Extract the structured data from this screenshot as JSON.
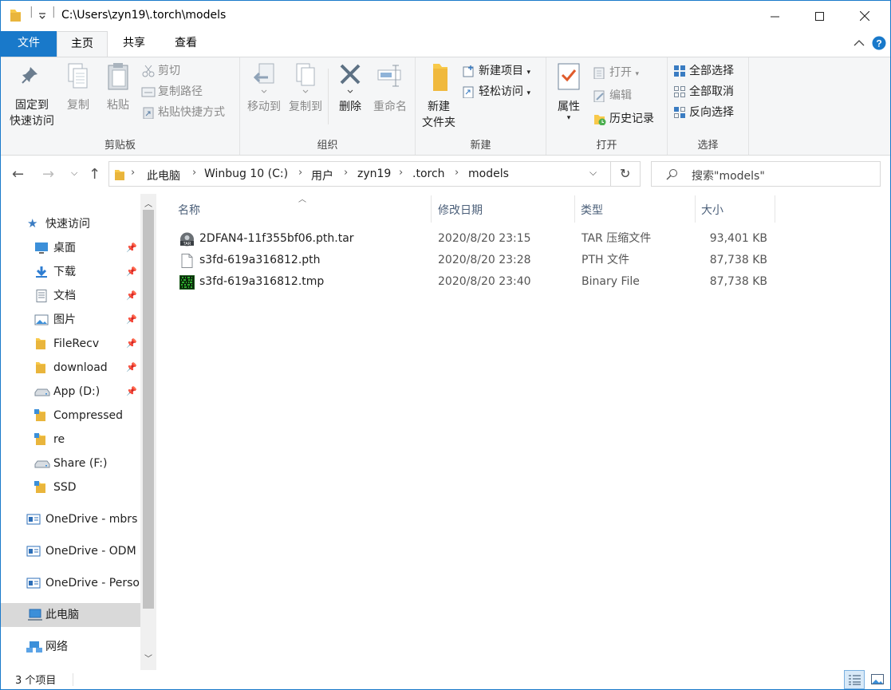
{
  "window": {
    "title": "C:\\Users\\zyn19\\.torch\\models"
  },
  "ribbon_tabs": [
    {
      "label": "文件"
    },
    {
      "label": "主页"
    },
    {
      "label": "共享"
    },
    {
      "label": "查看"
    }
  ],
  "ribbon": {
    "clipboard": {
      "label": "剪贴板",
      "pin": "固定到",
      "pin2": "快速访问",
      "copy": "复制",
      "paste": "粘贴",
      "cut": "剪切",
      "copy_path": "复制路径",
      "paste_shortcut": "粘贴快捷方式"
    },
    "organize": {
      "label": "组织",
      "move_to": "移动到",
      "copy_to": "复制到",
      "delete": "删除",
      "rename": "重命名"
    },
    "new": {
      "label": "新建",
      "new_folder": "新建",
      "new_folder2": "文件夹",
      "new_item": "新建项目",
      "easy_access": "轻松访问"
    },
    "open": {
      "label": "打开",
      "properties": "属性",
      "open": "打开",
      "edit": "编辑",
      "history": "历史记录"
    },
    "select": {
      "label": "选择",
      "select_all": "全部选择",
      "select_none": "全部取消",
      "invert": "反向选择"
    }
  },
  "address": {
    "crumbs": [
      "此电脑",
      "Winbug 10 (C:)",
      "用户",
      "zyn19",
      ".torch",
      "models"
    ],
    "search_placeholder": "搜索\"models\""
  },
  "nav": {
    "quick_access": "快速访问",
    "items": [
      {
        "label": "桌面",
        "icon": "desktop-icon",
        "pinned": true
      },
      {
        "label": "下载",
        "icon": "download-icon",
        "pinned": true
      },
      {
        "label": "文档",
        "icon": "document-icon",
        "pinned": true
      },
      {
        "label": "图片",
        "icon": "picture-icon",
        "pinned": true
      },
      {
        "label": "FileRecv",
        "icon": "folder-icon",
        "pinned": true
      },
      {
        "label": "download",
        "icon": "folder-icon",
        "pinned": true
      },
      {
        "label": "App (D:)",
        "icon": "drive-icon",
        "pinned": true
      },
      {
        "label": "Compressed",
        "icon": "folder-icon",
        "pinned": false
      },
      {
        "label": "re",
        "icon": "folder-icon",
        "pinned": false
      },
      {
        "label": "Share (F:)",
        "icon": "drive-icon",
        "pinned": false
      },
      {
        "label": "SSD",
        "icon": "folder-icon",
        "pinned": false
      }
    ],
    "onedrive": [
      "OneDrive - mbrs",
      "OneDrive - ODM",
      "OneDrive - Perso"
    ],
    "this_pc": "此电脑",
    "network": "网络"
  },
  "columns": {
    "name": "名称",
    "date": "修改日期",
    "type": "类型",
    "size": "大小"
  },
  "files": [
    {
      "name": "2DFAN4-11f355bf06.pth.tar",
      "date": "2020/8/20 23:15",
      "type": "TAR 压缩文件",
      "size": "93,401 KB",
      "icon": "tar-archive-icon"
    },
    {
      "name": "s3fd-619a316812.pth",
      "date": "2020/8/20 23:28",
      "type": "PTH 文件",
      "size": "87,738 KB",
      "icon": "file-icon"
    },
    {
      "name": "s3fd-619a316812.tmp",
      "date": "2020/8/20 23:40",
      "type": "Binary File",
      "size": "87,738 KB",
      "icon": "binary-file-icon"
    }
  ],
  "status": {
    "count": "3 个项目"
  },
  "colors": {
    "accent": "#1979ca",
    "folder": "#f8c94a",
    "ribbon_bg": "#f5f6f7",
    "header_text": "#4c607a"
  }
}
